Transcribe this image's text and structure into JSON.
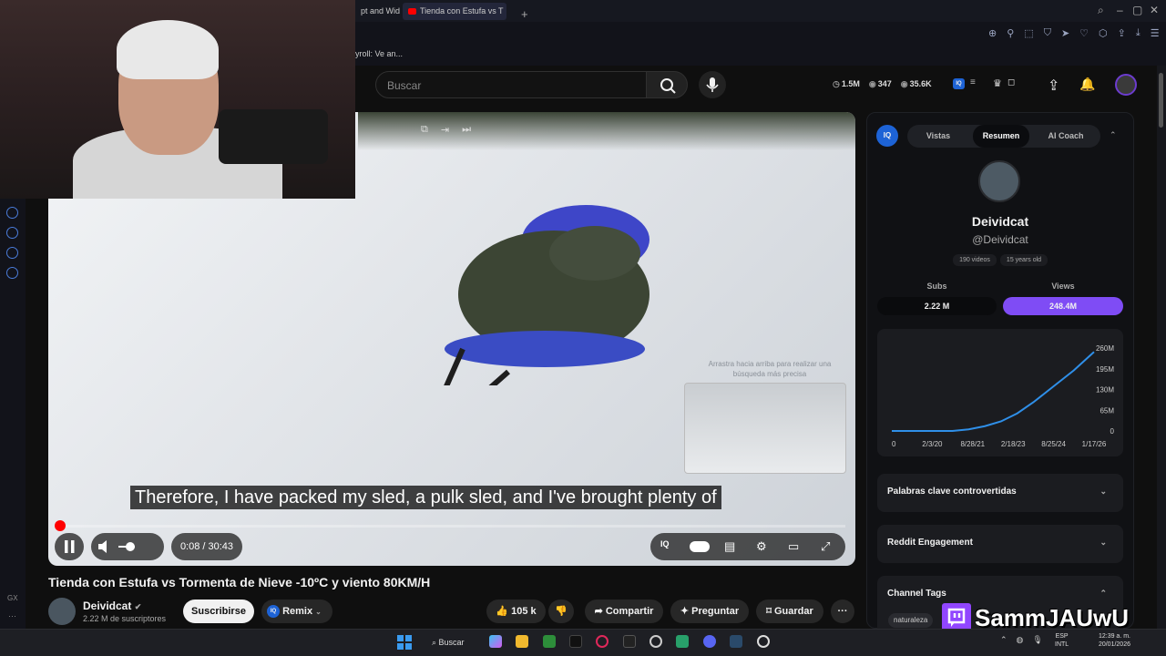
{
  "browser": {
    "tab_prev_label": "pt and Wid",
    "tab_active_label": "Tienda con Estufa vs T",
    "bookmark_label": "yroll: Ve an..."
  },
  "header": {
    "search_placeholder": "Buscar",
    "stats": {
      "views": "1.5M",
      "likes": "347",
      "comments": "35.6K"
    },
    "iq_label": "IQ"
  },
  "video": {
    "subtitle": "Therefore, I have packed my sled, a pulk sled, and I've brought plenty of",
    "time_display": "0:08 / 30:43",
    "progress_fraction": 0.0043,
    "preview_hint": "Arrastra hacia arriba para realizar una búsqueda más precisa",
    "title": "Tienda con Estufa vs Tormenta de Nieve -10ºC y viento 80KM/H"
  },
  "channel": {
    "name": "Deividcat",
    "subscribers": "2.22 M de suscriptores",
    "subscribe_label": "Suscribirse",
    "remix_label": "Remix"
  },
  "actions": {
    "likes": "105 k",
    "share": "Compartir",
    "ask": "Preguntar",
    "save": "Guardar"
  },
  "panel": {
    "iq_label": "IQ",
    "tabs": [
      "Vistas",
      "Resumen",
      "AI Coach"
    ],
    "active_tab": "Resumen",
    "name": "Deividcat",
    "handle": "@Deividcat",
    "videos_chip": "190 videos",
    "age_chip": "15 years old",
    "subs_label": "Subs",
    "views_label": "Views",
    "subs_value": "2.22 M",
    "views_value": "248.4M",
    "sections": [
      "Palabras clave controvertidas",
      "Reddit Engagement",
      "Channel Tags"
    ],
    "tag_chip": "naturaleza"
  },
  "chart_data": {
    "type": "line",
    "x": [
      "0",
      "2/3/20",
      "8/28/21",
      "2/18/23",
      "8/25/24",
      "1/17/26"
    ],
    "y_ticks": [
      "260M",
      "195M",
      "130M",
      "65M",
      "0"
    ],
    "ylim": [
      0,
      260
    ],
    "series": [
      {
        "values": [
          0,
          0,
          0,
          0,
          5,
          15,
          30,
          55,
          90,
          140,
          190,
          248
        ]
      }
    ],
    "series_x": [
      0,
      0.5,
      1,
      1.5,
      1.9,
      2.3,
      2.7,
      3.1,
      3.5,
      4.0,
      4.5,
      5
    ],
    "line_color": "#2f8fe8"
  },
  "overlay": {
    "streamer": "SammJAUwU"
  },
  "taskbar": {
    "search_label": "Buscar",
    "lang_line1": "ESP",
    "lang_line2": "INTL",
    "time": "12:39 a. m.",
    "date": "20/01/2026"
  }
}
